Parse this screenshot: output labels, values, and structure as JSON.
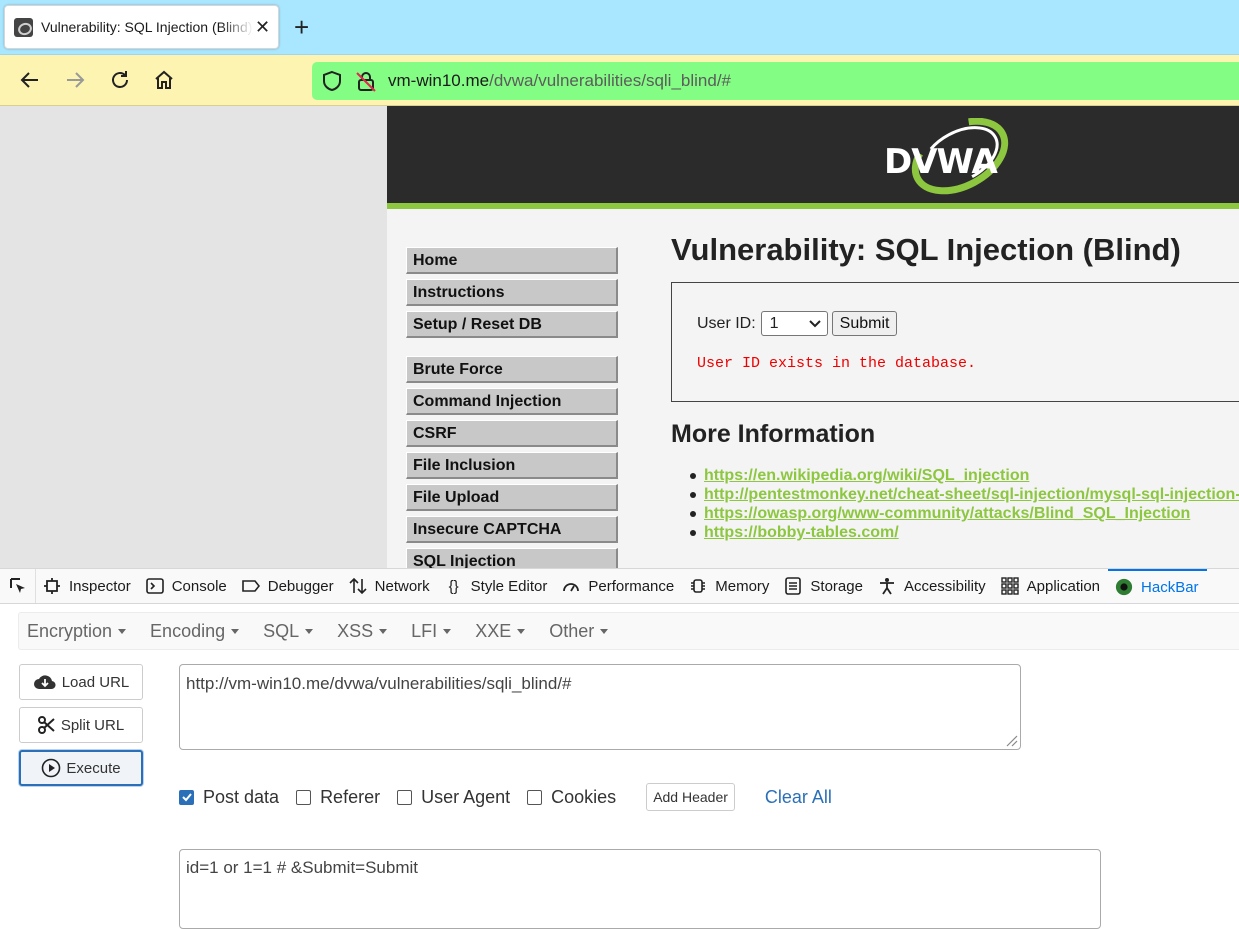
{
  "browser": {
    "tab_title": "Vulnerability: SQL Injection (Blind) :: Damn Vulnerable Web Application (DVWA)",
    "url_host": "vm-win10.me",
    "url_path": "/dvwa/vulnerabilities/sqli_blind/#"
  },
  "dvwa": {
    "logo_text": "DVWA",
    "menu_group1": [
      "Home",
      "Instructions",
      "Setup / Reset DB"
    ],
    "menu_group2": [
      "Brute Force",
      "Command Injection",
      "CSRF",
      "File Inclusion",
      "File Upload",
      "Insecure CAPTCHA",
      "SQL Injection"
    ],
    "heading": "Vulnerability: SQL Injection (Blind)",
    "form": {
      "label": "User ID:",
      "selected_value": "1",
      "submit_label": "Submit"
    },
    "result_message": "User ID exists in the database.",
    "more_info_heading": "More Information",
    "links": [
      "https://en.wikipedia.org/wiki/SQL_injection",
      "http://pentestmonkey.net/cheat-sheet/sql-injection/mysql-sql-injection-cheat-sheet",
      "https://owasp.org/www-community/attacks/Blind_SQL_Injection",
      "https://bobby-tables.com/"
    ],
    "accent_color": "#8dc63f"
  },
  "devtools": {
    "tabs": [
      "Inspector",
      "Console",
      "Debugger",
      "Network",
      "Style Editor",
      "Performance",
      "Memory",
      "Storage",
      "Accessibility",
      "Application",
      "HackBar"
    ],
    "hackbar": {
      "menus": [
        "Encryption",
        "Encoding",
        "SQL",
        "XSS",
        "LFI",
        "XXE",
        "Other"
      ],
      "buttons": {
        "load_url": "Load URL",
        "split_url": "Split URL",
        "execute": "Execute"
      },
      "url_value": "http://vm-win10.me/dvwa/vulnerabilities/sqli_blind/#",
      "options": {
        "post_data": "Post data",
        "referer": "Referer",
        "user_agent": "User Agent",
        "cookies": "Cookies",
        "post_data_checked": true
      },
      "add_header_label": "Add Header",
      "clear_all_label": "Clear All",
      "post_body": "id=1 or 1=1 # &Submit=Submit"
    }
  }
}
